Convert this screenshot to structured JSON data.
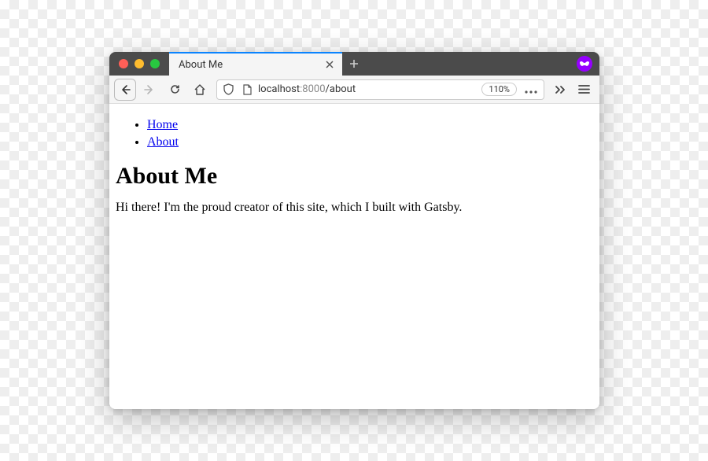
{
  "browser": {
    "tab_title": "About Me",
    "url": {
      "host": "localhost",
      "port": ":8000",
      "path": "/about"
    },
    "zoom": "110%"
  },
  "page": {
    "nav": [
      {
        "label": "Home"
      },
      {
        "label": "About"
      }
    ],
    "heading": "About Me",
    "paragraph": "Hi there! I'm the proud creator of this site, which I built with Gatsby."
  }
}
